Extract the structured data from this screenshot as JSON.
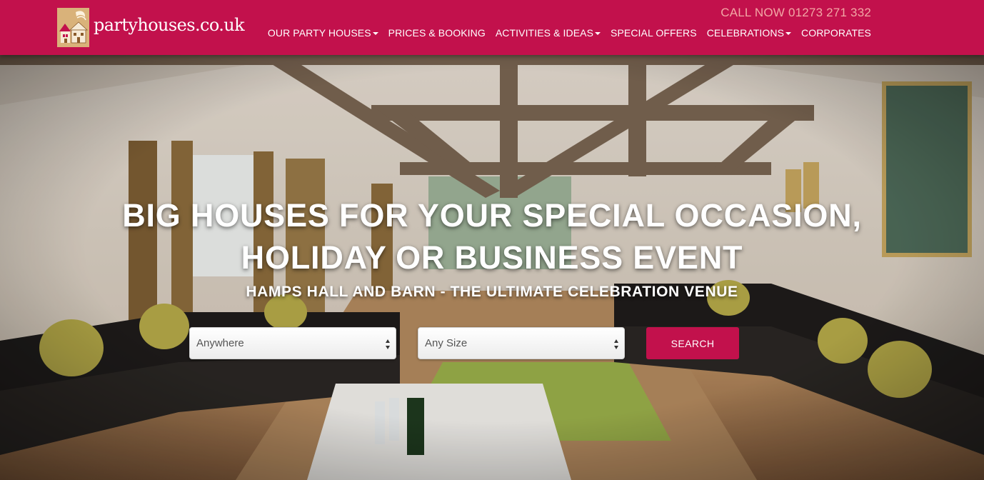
{
  "brand": {
    "logo_text": "partyhouses.co.uk",
    "logo_icon": "house-illustration-icon",
    "color_primary": "#c2114c",
    "color_callout": "#f2a7a5"
  },
  "header": {
    "call_now": "CALL NOW 01273 271 332",
    "nav": [
      {
        "label": "OUR PARTY HOUSES",
        "has_dropdown": true
      },
      {
        "label": "PRICES & BOOKING",
        "has_dropdown": false
      },
      {
        "label": "ACTIVITIES & IDEAS",
        "has_dropdown": true
      },
      {
        "label": "SPECIAL OFFERS",
        "has_dropdown": false
      },
      {
        "label": "CELEBRATIONS",
        "has_dropdown": true
      },
      {
        "label": "CORPORATES",
        "has_dropdown": false
      }
    ]
  },
  "hero": {
    "background": "photo-living-room-with-beams-and-leather-sofas",
    "headline_line1": "BIG HOUSES FOR YOUR SPECIAL OCCASION,",
    "headline_line2": "HOLIDAY OR BUSINESS EVENT",
    "subheadline": "HAMPS HALL AND BARN - THE ULTIMATE CELEBRATION VENUE"
  },
  "search": {
    "location_value": "Anywhere",
    "size_value": "Any Size",
    "button_label": "SEARCH"
  }
}
